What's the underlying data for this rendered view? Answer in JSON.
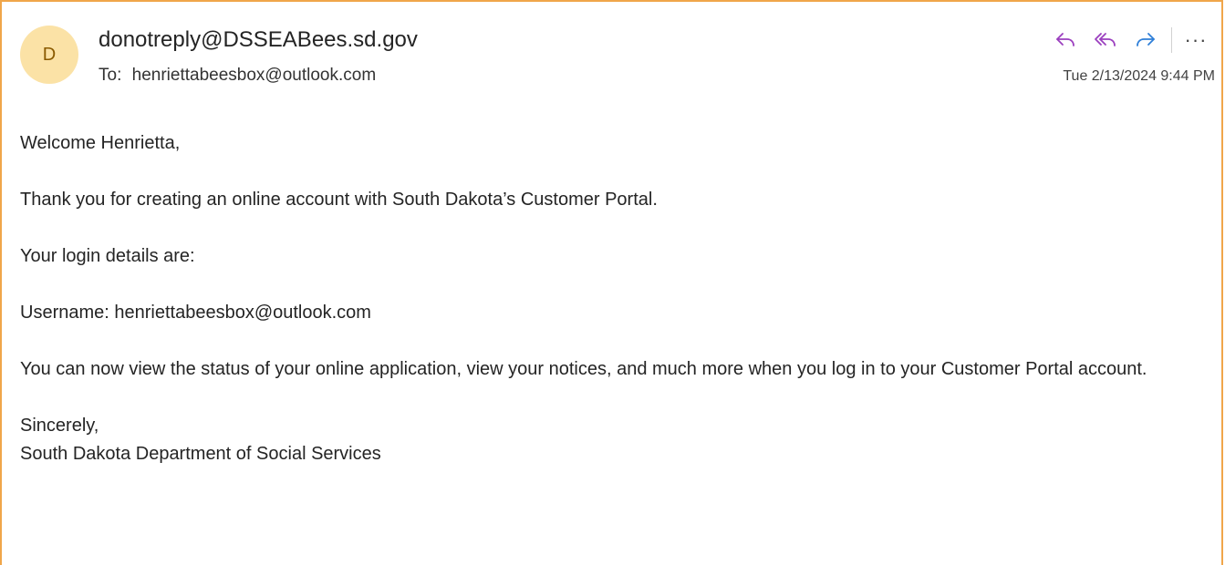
{
  "message": {
    "avatar_initial": "D",
    "sender": "donotreply@DSSEABees.sd.gov",
    "to_label": "To:",
    "recipient": "henriettabeesbox@outlook.com",
    "timestamp": "Tue 2/13/2024 9:44 PM"
  },
  "actions": {
    "reply": "reply-icon",
    "reply_all": "reply-all-icon",
    "forward": "forward-icon",
    "more": "···",
    "colors": {
      "reply": "#9b3fbf",
      "reply_all": "#9b3fbf",
      "forward": "#2f7fd8"
    }
  },
  "body": {
    "greeting": "Welcome Henrietta,",
    "paragraph1": "Thank you for creating an online account with South Dakota’s Customer Portal.",
    "paragraph2": "Your login details are:",
    "paragraph3": "Username: henriettabeesbox@outlook.com",
    "paragraph4": "You can now view the status of your online application, view your notices, and much more when you log in to your Customer Portal account.",
    "closing": "Sincerely,",
    "signature": "South Dakota Department of Social Services"
  },
  "colors": {
    "border": "#f0a64a",
    "avatar_bg": "#fbe2a6",
    "avatar_text": "#8a5a00"
  }
}
